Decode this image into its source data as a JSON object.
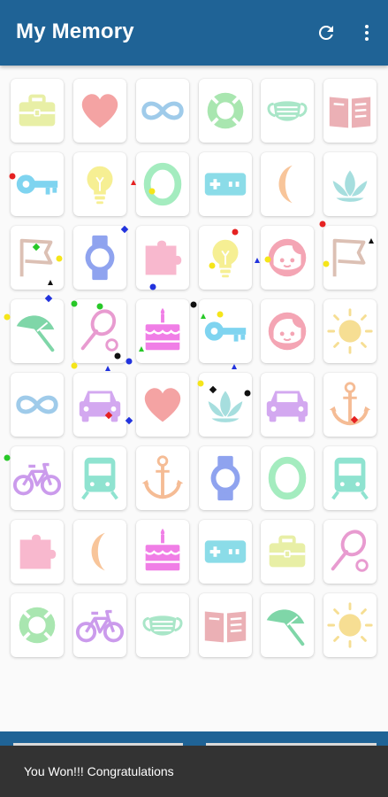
{
  "appbar": {
    "title": "My Memory",
    "actions": [
      "refresh-icon",
      "more-vert-icon"
    ]
  },
  "board": {
    "columns": 6,
    "rows": 8,
    "cards": [
      [
        "briefcase",
        "heart",
        "infinity",
        "lifebuoy",
        "mask",
        "book"
      ],
      [
        "key",
        "bulb",
        "ring",
        "gamepad",
        "moon",
        "lotus"
      ],
      [
        "flag",
        "watch",
        "puzzle",
        "bulb",
        "face",
        "flag"
      ],
      [
        "umbrella",
        "racket",
        "cake",
        "key",
        "face",
        "sun"
      ],
      [
        "infinity",
        "car",
        "heart",
        "lotus",
        "car",
        "anchor"
      ],
      [
        "bike",
        "train",
        "anchor",
        "watch",
        "ring",
        "train"
      ],
      [
        "puzzle",
        "moon",
        "cake",
        "gamepad",
        "briefcase",
        "racket"
      ],
      [
        "lifebuoy",
        "bike",
        "mask",
        "book",
        "umbrella",
        "sun"
      ]
    ],
    "colors": {
      "briefcase": "#e8efa6",
      "heart": "#f4a3a3",
      "infinity": "#9fcbea",
      "lifebuoy": "#a9e6b0",
      "mask": "#a9e6c8",
      "book": "#ebb0b5",
      "key": "#7fd4f0",
      "bulb": "#f6ef93",
      "ring": "#a4ecbf",
      "gamepad": "#8bdce8",
      "moon": "#f8c59a",
      "lotus": "#a6dede",
      "flag": "#dcc0b4",
      "watch": "#8fa3ef",
      "puzzle": "#f8b8ce",
      "face": "#f4a5b4",
      "sun": "#f6de93",
      "umbrella": "#7fd6a8",
      "racket": "#e89bd0",
      "cake": "#f07ee6",
      "car": "#d3a8f0",
      "anchor": "#f5bc95",
      "bike": "#cb9bec",
      "train": "#8fe3d0"
    }
  },
  "snackbar": {
    "message": "You Won!!! Congratulations"
  }
}
